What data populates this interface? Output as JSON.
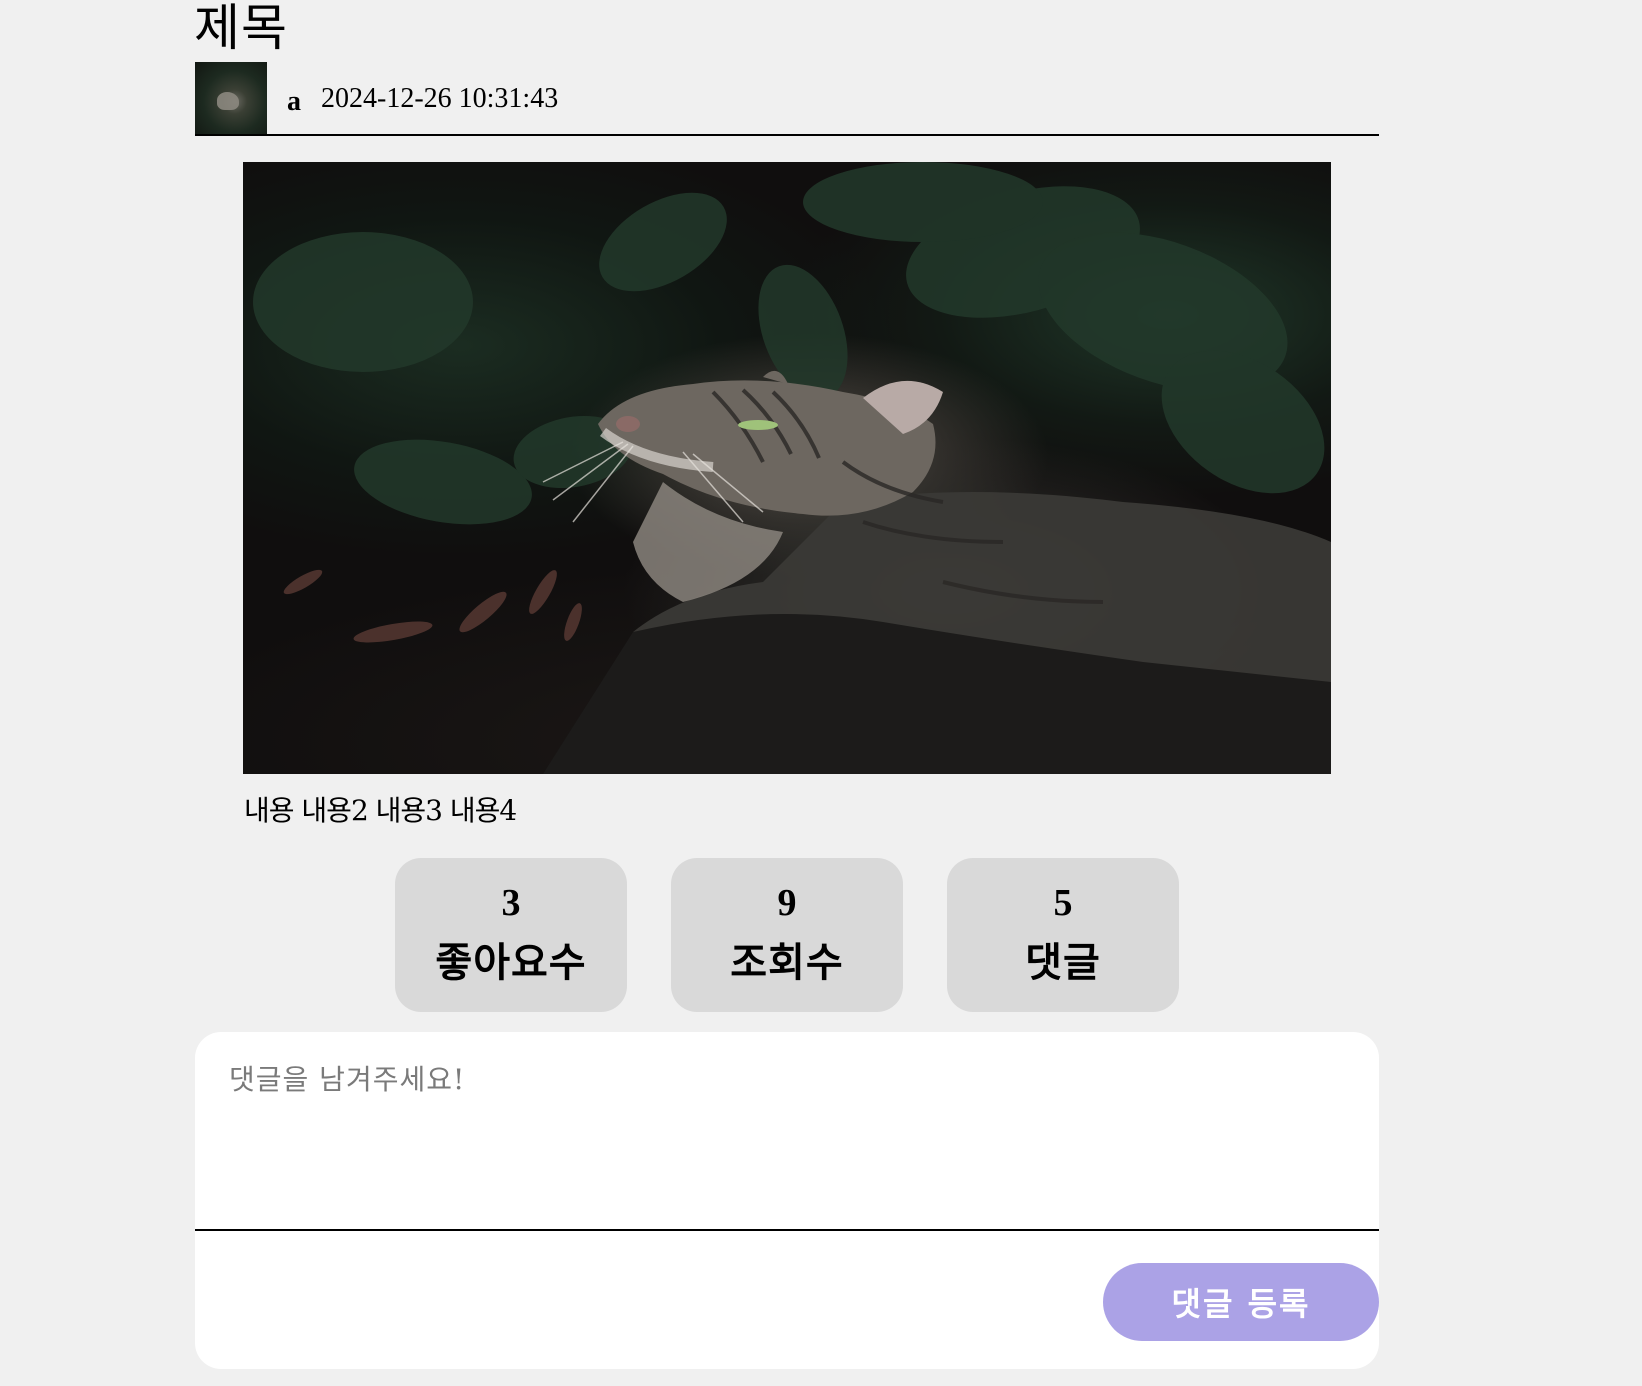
{
  "post": {
    "title": "제목",
    "author": "a",
    "date": "2024-12-26 10:31:43",
    "content": "내용 내용2 내용3 내용4"
  },
  "stats": {
    "likes": {
      "value": "3",
      "label": "좋아요수"
    },
    "views": {
      "value": "9",
      "label": "조회수"
    },
    "comments": {
      "value": "5",
      "label": "댓글"
    }
  },
  "comment_form": {
    "placeholder": "댓글을 남겨주세요!",
    "submit_label": "댓글 등록"
  },
  "colors": {
    "background": "#f0f0f0",
    "stat_box": "#d9d9d9",
    "submit_button": "#aba2e6",
    "card": "#ffffff"
  }
}
